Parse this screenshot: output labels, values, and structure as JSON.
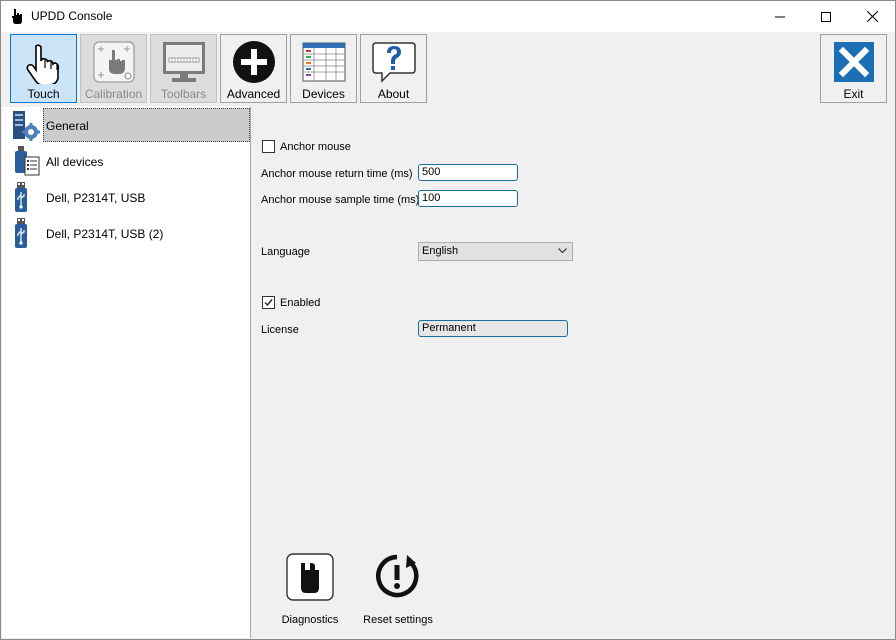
{
  "window": {
    "title": "UPDD Console"
  },
  "titlebar_buttons": {
    "minimize": "minimize-icon",
    "maximize": "maximize-icon",
    "close": "close-icon"
  },
  "toolbar": {
    "buttons": [
      {
        "label": "Touch",
        "icon": "hand-touch-icon",
        "state": "active"
      },
      {
        "label": "Calibration",
        "icon": "calibration-icon",
        "state": "disabled"
      },
      {
        "label": "Toolbars",
        "icon": "monitor-toolbar-icon",
        "state": "disabled"
      },
      {
        "label": "Advanced",
        "icon": "plus-circle-icon",
        "state": "normal"
      },
      {
        "label": "Devices",
        "icon": "device-list-icon",
        "state": "normal"
      },
      {
        "label": "About",
        "icon": "question-bubble-icon",
        "state": "normal"
      }
    ],
    "exit": {
      "label": "Exit",
      "icon": "exit-x-icon"
    }
  },
  "sidebar": {
    "items": [
      {
        "label": "General",
        "icon": "general-settings-icon",
        "selected": true
      },
      {
        "label": "All devices",
        "icon": "all-devices-icon",
        "selected": false
      },
      {
        "label": "Dell, P2314T, USB",
        "icon": "usb-device-icon",
        "selected": false
      },
      {
        "label": "Dell, P2314T, USB (2)",
        "icon": "usb-device-icon",
        "selected": false
      }
    ]
  },
  "settings": {
    "anchor_mouse": {
      "label": "Anchor mouse",
      "checked": false
    },
    "return_time": {
      "label": "Anchor mouse return time (ms)",
      "value": "500"
    },
    "sample_time": {
      "label": "Anchor mouse sample time (ms)",
      "value": "100"
    },
    "language": {
      "label": "Language",
      "value": "English"
    },
    "enabled": {
      "label": "Enabled",
      "checked": true
    },
    "license": {
      "label": "License",
      "value": "Permanent"
    }
  },
  "bottom_buttons": {
    "diagnostics": {
      "label": "Diagnostics",
      "icon": "diagnostics-icon"
    },
    "reset": {
      "label": "Reset settings",
      "icon": "reset-icon"
    }
  },
  "colors": {
    "active_toolbar_bg": "#cce4f7",
    "active_toolbar_border": "#0078d7",
    "field_border": "#1a6e9e",
    "exit_blue": "#1d6fb5"
  }
}
